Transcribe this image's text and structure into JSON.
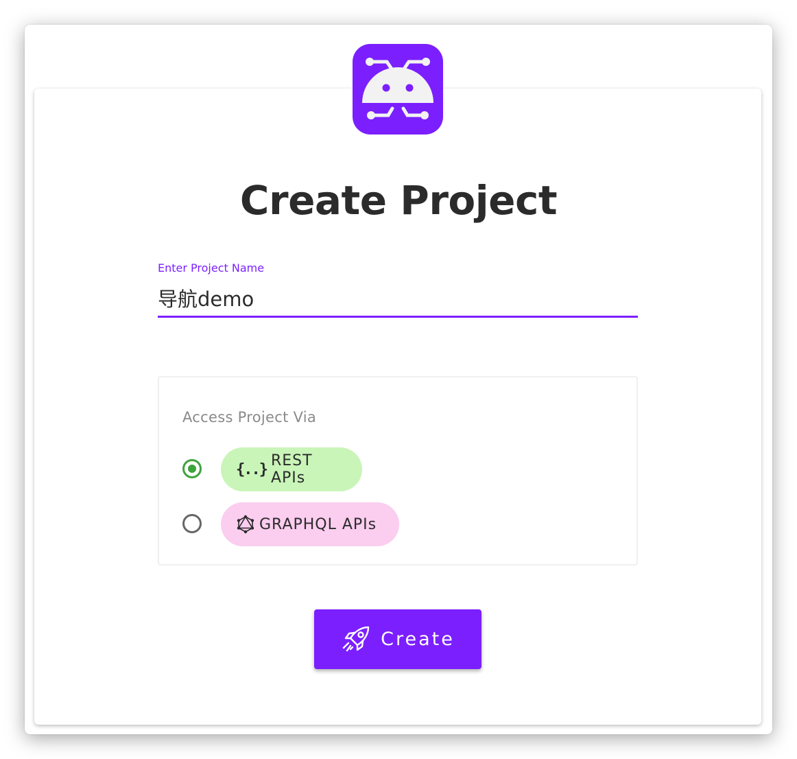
{
  "logo": {
    "icon": "robot-antenna-logo",
    "background": "#7b1fff"
  },
  "title": "Create Project",
  "project_name": {
    "label": "Enter Project Name",
    "value": "导航demo"
  },
  "access": {
    "label": "Access Project Via",
    "options": [
      {
        "label": "REST APIs",
        "icon_text": "{..}",
        "icon": "curly-braces-icon",
        "checked": true,
        "color": "#c9f5b8"
      },
      {
        "label": "GRAPHQL APIs",
        "icon": "graphql-icon",
        "checked": false,
        "color": "#fbcdef"
      }
    ]
  },
  "create_button": {
    "label": "Create",
    "icon": "rocket-icon"
  },
  "colors": {
    "accent": "#7b1fff",
    "radio_checked": "#3da33d",
    "text": "#2b2b2b"
  }
}
